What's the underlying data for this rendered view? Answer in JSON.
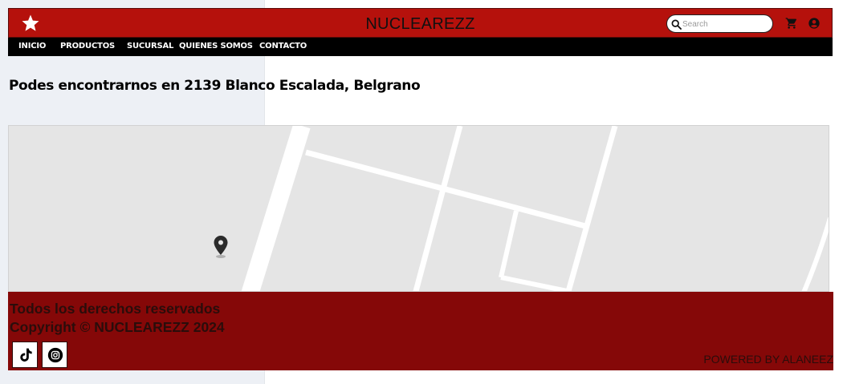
{
  "header": {
    "brand": "NUCLEAREZZ",
    "search_placeholder": "Search",
    "icons": [
      "star-icon",
      "search-icon",
      "cart-icon",
      "account-icon"
    ]
  },
  "nav": {
    "items": [
      "INICIO",
      "PRODUCTOS",
      "SUCURSAL",
      "QUIENES SOMOS",
      "CONTACTO"
    ]
  },
  "main": {
    "headline": "Podes encontrarnos en 2139 Blanco Escalada, Belgrano"
  },
  "map": {
    "marker_icon": "map-pin-icon"
  },
  "footer": {
    "rights": "Todos los derechos reservados",
    "copyright": "Copyright © NUCLEAREZZ 2024",
    "powered_by": "POWERED BY ALANEEZ",
    "social": [
      "tiktok-icon",
      "instagram-icon"
    ]
  },
  "colors": {
    "header_red": "#b5110c",
    "nav_black": "#000000",
    "footer_red": "#850808",
    "page_left_bg": "#edf0f5"
  }
}
